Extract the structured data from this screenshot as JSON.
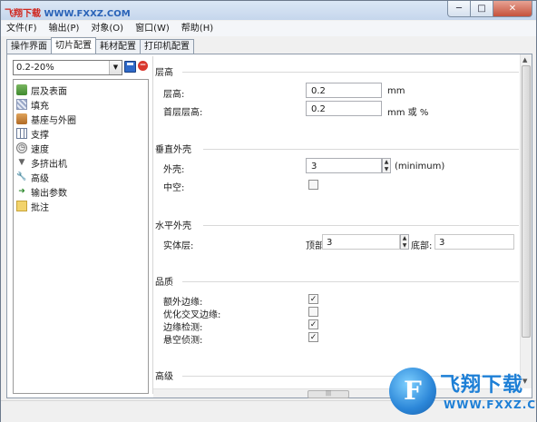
{
  "watermark": {
    "part1": "飞翔下载",
    "part2": " WWW.FXXZ.COM"
  },
  "window_buttons": {
    "minimize": "─",
    "maximize": "□",
    "close": "✕"
  },
  "menu": [
    "文件(F)",
    "输出(P)",
    "对象(O)",
    "窗口(W)",
    "帮助(H)"
  ],
  "tabs": [
    {
      "label": "操作界面",
      "active": false
    },
    {
      "label": "切片配置",
      "active": true
    },
    {
      "label": "耗材配置",
      "active": false
    },
    {
      "label": "打印机配置",
      "active": false
    }
  ],
  "preset": {
    "value": "0.2-20%"
  },
  "tree": [
    {
      "label": "层及表面",
      "icon": "layers-icon"
    },
    {
      "label": "填充",
      "icon": "infill-icon"
    },
    {
      "label": "基座与外圈",
      "icon": "skirt-icon"
    },
    {
      "label": "支撑",
      "icon": "support-icon"
    },
    {
      "label": "速度",
      "icon": "speed-icon"
    },
    {
      "label": "多挤出机",
      "icon": "funnel-icon"
    },
    {
      "label": "高级",
      "icon": "wrench-icon"
    },
    {
      "label": "输出参数",
      "icon": "output-icon"
    },
    {
      "label": "批注",
      "icon": "notes-icon"
    }
  ],
  "sections": {
    "layer_height": {
      "title": "层高",
      "layer_label": "层高:",
      "layer_value": "0.2",
      "layer_unit": "mm",
      "first_label": "首层层高:",
      "first_value": "0.2",
      "first_unit": "mm 或 %"
    },
    "vertical_shells": {
      "title": "垂直外壳",
      "perimeters_label": "外壳:",
      "perimeters_value": "3",
      "perimeters_hint": "(minimum)",
      "spiral_label": "中空:",
      "spiral_checked": false
    },
    "horizontal_shells": {
      "title": "水平外壳",
      "solid_label": "实体层:",
      "top_label": "顶部:",
      "top_value": "3",
      "bottom_label": "底部:",
      "bottom_value": "3"
    },
    "quality": {
      "title": "品质",
      "items": [
        {
          "label": "额外边缘:",
          "checked": true
        },
        {
          "label": "优化交叉边缘:",
          "checked": false
        },
        {
          "label": "边缘检测:",
          "checked": true
        },
        {
          "label": "悬空侦测:",
          "checked": true
        }
      ]
    },
    "advanced": {
      "title": "高级"
    }
  },
  "logo": {
    "mark": "F",
    "name": "飞翔下载",
    "url": "WWW.FXXZ.COM"
  }
}
